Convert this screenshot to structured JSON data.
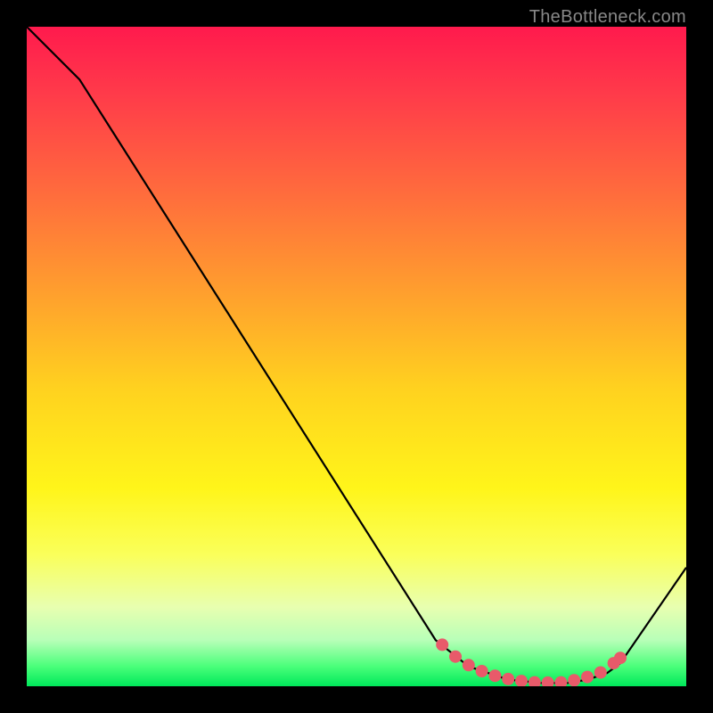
{
  "watermark": "TheBottleneck.com",
  "chart_data": {
    "type": "line",
    "title": "",
    "xlabel": "",
    "ylabel": "",
    "xlim": [
      0,
      100
    ],
    "ylim": [
      0,
      100
    ],
    "series": [
      {
        "name": "bottleneck-curve",
        "x": [
          0,
          8,
          62,
          67,
          73,
          78,
          82,
          85,
          88,
          90,
          100
        ],
        "y": [
          100,
          92,
          7,
          3,
          1,
          0.5,
          0.5,
          1,
          2,
          3.5,
          18
        ],
        "color": "#000000"
      }
    ],
    "markers": {
      "name": "optimal-zone-dots",
      "points": [
        {
          "x": 63,
          "y": 6.3
        },
        {
          "x": 65,
          "y": 4.5
        },
        {
          "x": 67,
          "y": 3.2
        },
        {
          "x": 69,
          "y": 2.3
        },
        {
          "x": 71,
          "y": 1.6
        },
        {
          "x": 73,
          "y": 1.1
        },
        {
          "x": 75,
          "y": 0.8
        },
        {
          "x": 77,
          "y": 0.6
        },
        {
          "x": 79,
          "y": 0.55
        },
        {
          "x": 81,
          "y": 0.6
        },
        {
          "x": 83,
          "y": 0.9
        },
        {
          "x": 85,
          "y": 1.4
        },
        {
          "x": 87,
          "y": 2.1
        },
        {
          "x": 89,
          "y": 3.5
        },
        {
          "x": 90,
          "y": 4.3
        }
      ],
      "color": "#e85a6a",
      "radius": 7
    }
  }
}
